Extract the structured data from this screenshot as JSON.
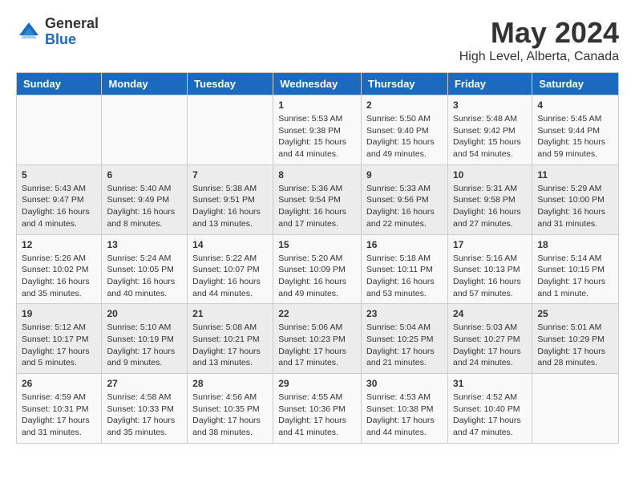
{
  "logo": {
    "general": "General",
    "blue": "Blue"
  },
  "title": "May 2024",
  "location": "High Level, Alberta, Canada",
  "days_header": [
    "Sunday",
    "Monday",
    "Tuesday",
    "Wednesday",
    "Thursday",
    "Friday",
    "Saturday"
  ],
  "weeks": [
    [
      {
        "day": "",
        "info": ""
      },
      {
        "day": "",
        "info": ""
      },
      {
        "day": "",
        "info": ""
      },
      {
        "day": "1",
        "info": "Sunrise: 5:53 AM\nSunset: 9:38 PM\nDaylight: 15 hours\nand 44 minutes."
      },
      {
        "day": "2",
        "info": "Sunrise: 5:50 AM\nSunset: 9:40 PM\nDaylight: 15 hours\nand 49 minutes."
      },
      {
        "day": "3",
        "info": "Sunrise: 5:48 AM\nSunset: 9:42 PM\nDaylight: 15 hours\nand 54 minutes."
      },
      {
        "day": "4",
        "info": "Sunrise: 5:45 AM\nSunset: 9:44 PM\nDaylight: 15 hours\nand 59 minutes."
      }
    ],
    [
      {
        "day": "5",
        "info": "Sunrise: 5:43 AM\nSunset: 9:47 PM\nDaylight: 16 hours\nand 4 minutes."
      },
      {
        "day": "6",
        "info": "Sunrise: 5:40 AM\nSunset: 9:49 PM\nDaylight: 16 hours\nand 8 minutes."
      },
      {
        "day": "7",
        "info": "Sunrise: 5:38 AM\nSunset: 9:51 PM\nDaylight: 16 hours\nand 13 minutes."
      },
      {
        "day": "8",
        "info": "Sunrise: 5:36 AM\nSunset: 9:54 PM\nDaylight: 16 hours\nand 17 minutes."
      },
      {
        "day": "9",
        "info": "Sunrise: 5:33 AM\nSunset: 9:56 PM\nDaylight: 16 hours\nand 22 minutes."
      },
      {
        "day": "10",
        "info": "Sunrise: 5:31 AM\nSunset: 9:58 PM\nDaylight: 16 hours\nand 27 minutes."
      },
      {
        "day": "11",
        "info": "Sunrise: 5:29 AM\nSunset: 10:00 PM\nDaylight: 16 hours\nand 31 minutes."
      }
    ],
    [
      {
        "day": "12",
        "info": "Sunrise: 5:26 AM\nSunset: 10:02 PM\nDaylight: 16 hours\nand 35 minutes."
      },
      {
        "day": "13",
        "info": "Sunrise: 5:24 AM\nSunset: 10:05 PM\nDaylight: 16 hours\nand 40 minutes."
      },
      {
        "day": "14",
        "info": "Sunrise: 5:22 AM\nSunset: 10:07 PM\nDaylight: 16 hours\nand 44 minutes."
      },
      {
        "day": "15",
        "info": "Sunrise: 5:20 AM\nSunset: 10:09 PM\nDaylight: 16 hours\nand 49 minutes."
      },
      {
        "day": "16",
        "info": "Sunrise: 5:18 AM\nSunset: 10:11 PM\nDaylight: 16 hours\nand 53 minutes."
      },
      {
        "day": "17",
        "info": "Sunrise: 5:16 AM\nSunset: 10:13 PM\nDaylight: 16 hours\nand 57 minutes."
      },
      {
        "day": "18",
        "info": "Sunrise: 5:14 AM\nSunset: 10:15 PM\nDaylight: 17 hours\nand 1 minute."
      }
    ],
    [
      {
        "day": "19",
        "info": "Sunrise: 5:12 AM\nSunset: 10:17 PM\nDaylight: 17 hours\nand 5 minutes."
      },
      {
        "day": "20",
        "info": "Sunrise: 5:10 AM\nSunset: 10:19 PM\nDaylight: 17 hours\nand 9 minutes."
      },
      {
        "day": "21",
        "info": "Sunrise: 5:08 AM\nSunset: 10:21 PM\nDaylight: 17 hours\nand 13 minutes."
      },
      {
        "day": "22",
        "info": "Sunrise: 5:06 AM\nSunset: 10:23 PM\nDaylight: 17 hours\nand 17 minutes."
      },
      {
        "day": "23",
        "info": "Sunrise: 5:04 AM\nSunset: 10:25 PM\nDaylight: 17 hours\nand 21 minutes."
      },
      {
        "day": "24",
        "info": "Sunrise: 5:03 AM\nSunset: 10:27 PM\nDaylight: 17 hours\nand 24 minutes."
      },
      {
        "day": "25",
        "info": "Sunrise: 5:01 AM\nSunset: 10:29 PM\nDaylight: 17 hours\nand 28 minutes."
      }
    ],
    [
      {
        "day": "26",
        "info": "Sunrise: 4:59 AM\nSunset: 10:31 PM\nDaylight: 17 hours\nand 31 minutes."
      },
      {
        "day": "27",
        "info": "Sunrise: 4:58 AM\nSunset: 10:33 PM\nDaylight: 17 hours\nand 35 minutes."
      },
      {
        "day": "28",
        "info": "Sunrise: 4:56 AM\nSunset: 10:35 PM\nDaylight: 17 hours\nand 38 minutes."
      },
      {
        "day": "29",
        "info": "Sunrise: 4:55 AM\nSunset: 10:36 PM\nDaylight: 17 hours\nand 41 minutes."
      },
      {
        "day": "30",
        "info": "Sunrise: 4:53 AM\nSunset: 10:38 PM\nDaylight: 17 hours\nand 44 minutes."
      },
      {
        "day": "31",
        "info": "Sunrise: 4:52 AM\nSunset: 10:40 PM\nDaylight: 17 hours\nand 47 minutes."
      },
      {
        "day": "",
        "info": ""
      }
    ]
  ]
}
